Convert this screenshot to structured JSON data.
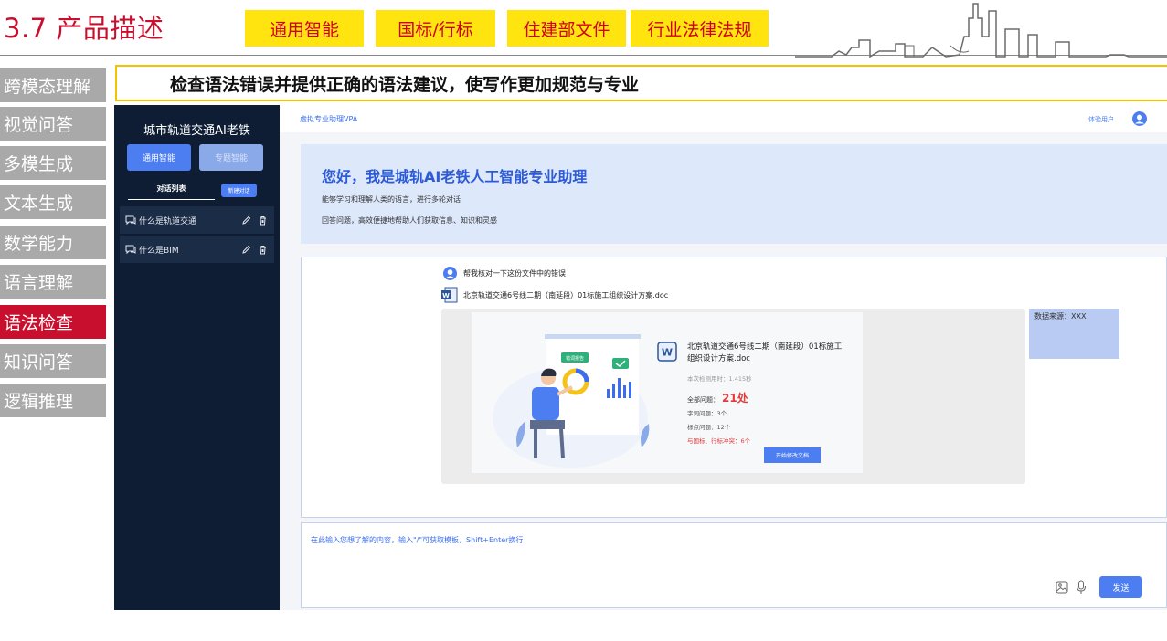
{
  "slide": {
    "title": "3.7 产品描述",
    "tags": [
      "通用智能",
      "国标/行标",
      "住建部文件",
      "行业法律法规"
    ],
    "banner": "检查语法错误并提供正确的语法建议，使写作更加规范与专业",
    "nav": [
      "跨模态理解",
      "视觉问答",
      "多模生成",
      "文本生成",
      "数学能力",
      "语言理解",
      "语法检查",
      "知识问答",
      "逻辑推理"
    ],
    "nav_active": "语法检查"
  },
  "app": {
    "sidebar": {
      "app_name": "城市轨道交通AI老铁",
      "mode_general": "通用智能",
      "mode_special": "专题智能",
      "conversation_list_label": "对话列表",
      "new_conversation_label": "新建对话",
      "conversations": [
        "什么是轨道交通",
        "什么是BIM"
      ]
    },
    "topbar": {
      "brand": "虚拟专业助理VPA",
      "user_label": "体验用户"
    },
    "welcome": {
      "title": "您好，我是城轨AI老铁人工智能专业助理",
      "line1": "能够学习和理解人类的语言，进行多轮对话",
      "line2": "回答问题，高效便捷地帮助人们获取信息、知识和灵感"
    },
    "chat": {
      "user_message": "帮我核对一下这份文件中的错误",
      "attached_file": "北京轨道交通6号线二期（南延段）01标施工组织设计方案.doc",
      "result": {
        "illustration_badge": "错词报告",
        "doc_name": "北京轨道交通6号线二期（南延段）01标施工组织设计方案.doc",
        "detection_time": "本次检测用时：1.415秒",
        "total_label": "全部问题：",
        "total_value": "21处",
        "word_issues": "字词问题：3个",
        "punct_issues": "标点问题：12个",
        "standard_conflicts": "与国标、行标冲突：6个",
        "fix_button": "开始修改文档"
      },
      "source": "数据来源：XXX"
    },
    "input": {
      "placeholder": "在此输入您想了解的内容，输入\"/\"可获取模板，Shift+Enter换行",
      "send_label": "发送"
    }
  },
  "colors": {
    "accent": "#c8102e",
    "tag_bg": "#ffe40f",
    "primary_blue": "#4c7ef2",
    "sidebar_dark": "#0e1d33"
  }
}
